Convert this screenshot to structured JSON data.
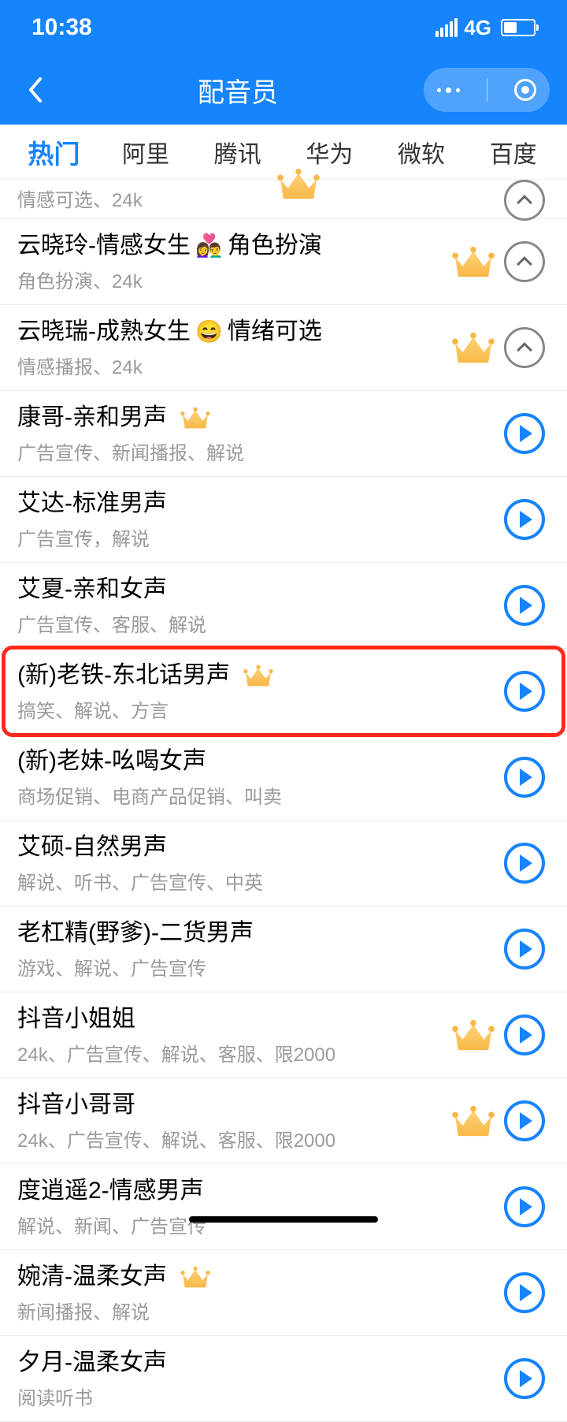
{
  "status": {
    "time": "10:38",
    "network": "4G"
  },
  "nav": {
    "title": "配音员"
  },
  "tabs": [
    "热门",
    "阿里",
    "腾讯",
    "华为",
    "微软",
    "百度"
  ],
  "activeTab": 0,
  "items": [
    {
      "title": "",
      "sub": "情感可选、24k",
      "crown": "large",
      "action": "chevron",
      "partial": true
    },
    {
      "title": "云晓玲-情感女生",
      "emoji": "👩‍❤️‍👨",
      "suffix": "角色扮演",
      "sub": "角色扮演、24k",
      "crown": "large",
      "action": "chevron"
    },
    {
      "title": "云晓瑞-成熟女生",
      "emoji": "😄",
      "suffix": "情绪可选",
      "sub": "情感播报、24k",
      "crown": "large",
      "action": "chevron"
    },
    {
      "title": "康哥-亲和男声",
      "sub": "广告宣传、新闻播报、解说",
      "crown": "small",
      "action": "play"
    },
    {
      "title": "艾达-标准男声",
      "sub": "广告宣传，解说",
      "crown": "none",
      "action": "play"
    },
    {
      "title": "艾夏-亲和女声",
      "sub": "广告宣传、客服、解说",
      "crown": "none",
      "action": "play"
    },
    {
      "title": "(新)老铁-东北话男声",
      "sub": "搞笑、解说、方言",
      "crown": "small",
      "action": "play",
      "highlighted": true
    },
    {
      "title": "(新)老妹-吆喝女声",
      "sub": "商场促销、电商产品促销、叫卖",
      "crown": "none",
      "action": "play"
    },
    {
      "title": "艾硕-自然男声",
      "sub": "解说、听书、广告宣传、中英",
      "crown": "none",
      "action": "play"
    },
    {
      "title": "老杠精(野爹)-二货男声",
      "sub": "游戏、解说、广告宣传",
      "crown": "none",
      "action": "play"
    },
    {
      "title": "抖音小姐姐",
      "sub": "24k、广告宣传、解说、客服、限2000",
      "crown": "large",
      "action": "play"
    },
    {
      "title": "抖音小哥哥",
      "sub": "24k、广告宣传、解说、客服、限2000",
      "crown": "large",
      "action": "play"
    },
    {
      "title": "度逍遥2-情感男声",
      "sub": "解说、新闻、广告宣传",
      "crown": "none",
      "action": "play"
    },
    {
      "title": "婉清-温柔女声",
      "sub": "新闻播报、解说",
      "crown": "small",
      "action": "play"
    },
    {
      "title": "夕月-温柔女声",
      "sub": "阅读听书",
      "crown": "none",
      "action": "play"
    }
  ]
}
